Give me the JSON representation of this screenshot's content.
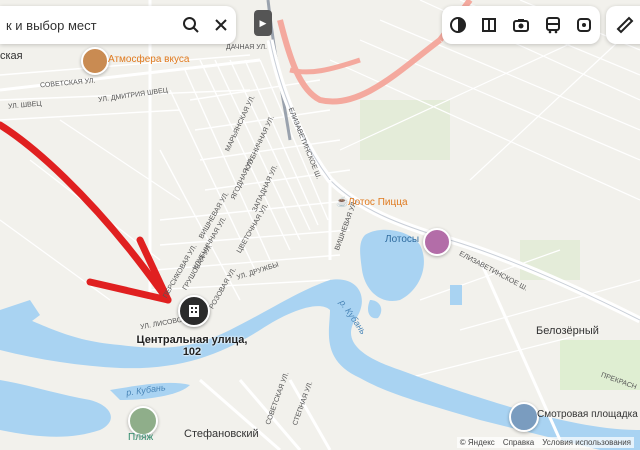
{
  "search": {
    "value": "к и выбор мест"
  },
  "toolbar": {
    "icons": [
      "layers-icon",
      "panorama-icon",
      "photo-icon",
      "transit-icon",
      "route-icon"
    ]
  },
  "places": {
    "left_town": "ская",
    "stefanovsky": "Стефановский",
    "belozerny": "Белозёрный",
    "lotosy": "Лотосы",
    "plyazh": "Пляж",
    "smotrovaya": "Смотровая площадка"
  },
  "pois": {
    "atmosfera": "Атмосфера вкуса",
    "lotos_pizza": "Лотос Пицца"
  },
  "address": {
    "line1": "Центральная улица,",
    "line2": "102"
  },
  "rivers": {
    "kuban_1": "р. Кубань",
    "kuban_2": "р. Кубань"
  },
  "streets": {
    "sovetskaya": "СОВЕТСКАЯ УЛ.",
    "dmitriya": "УЛ. ДМИТРИЯ ШВЕЦ",
    "shvets": "УЛ. ШВЕЦ",
    "dachnaya": "ДАЧНАЯ УЛ.",
    "elizavetinskoe_1": "ЕЛИЗАВЕТИНСКОЕ Ш.",
    "elizavetinskoe_2": "ЕЛИЗАВЕТИНСКОЕ Ш.",
    "maryanskaya": "МАРЬЯНСКАЯ УЛ.",
    "klubnichnaya": "КЛУБНИЧНАЯ УЛ.",
    "yagodnaya": "ЯГОДНАЯ УЛ.",
    "zapadnaya": "ЗАПАДНАЯ УЛ.",
    "vishnevaya_1": "ВИШНЕВАЯ УЛ.",
    "vishnevaya_2": "ВИШНЕВАЯ УЛ.",
    "tsvetochnaya": "ЦВЕТОЧНАЯ УЛ.",
    "klubnichnaya_2": "КЛУБНИЧНАЯ УЛ.",
    "druzhby": "УЛ. ДРУЖБЫ",
    "grushovaya": "ГРУШОВАЯ УЛ.",
    "persikovaya": "ПЕРСИКОВАЯ УЛ.",
    "rozovaya": "РОЗОВАЯ УЛ.",
    "lisovaya": "УЛ. ЛИСОВОЙ",
    "sovetskaya_2": "СОВЕТСКАЯ УЛ.",
    "stepnaya": "СТЕПНАЯ УЛ.",
    "prekrasnaya": "ПРЕКРАСН"
  },
  "footer": {
    "yandex": "© Яндекс",
    "help": "Справка",
    "terms": "Условия использования"
  },
  "colors": {
    "river": "#a9d3f2",
    "highway": "#f4a99e",
    "road": "#ffffff",
    "arrow": "#e02020",
    "land": "#f2f1ec",
    "green": "#d3ebc0"
  }
}
